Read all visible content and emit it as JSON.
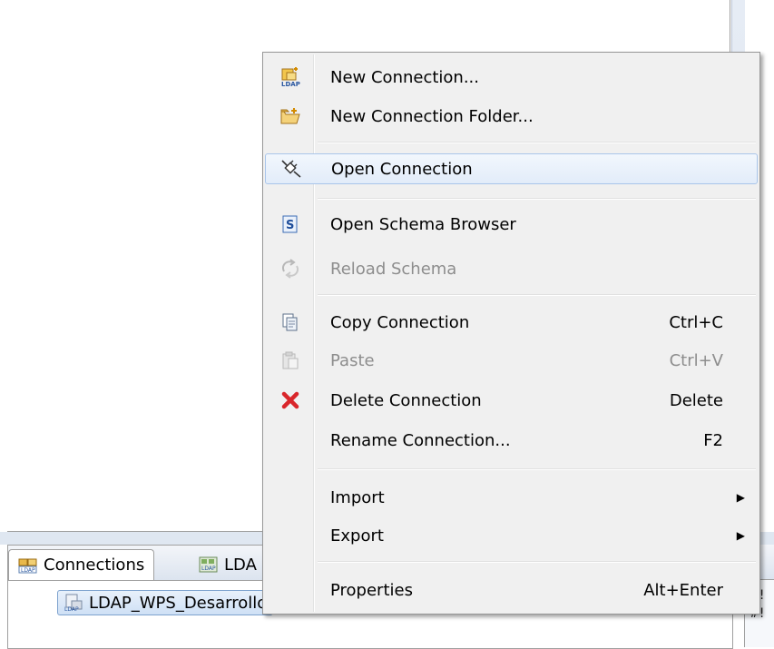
{
  "menu": {
    "items": [
      {
        "label": "New Connection...",
        "shortcut": "",
        "icon": "new-ldap-connection-icon"
      },
      {
        "label": "New Connection Folder...",
        "shortcut": "",
        "icon": "new-folder-icon"
      },
      {
        "label": "Open Connection",
        "shortcut": "",
        "icon": "plug-connect-icon",
        "highlighted": true
      },
      {
        "label": "Open Schema Browser",
        "shortcut": "",
        "icon": "schema-icon"
      },
      {
        "label": "Reload Schema",
        "shortcut": "",
        "icon": "reload-icon",
        "disabled": true
      },
      {
        "label": "Copy Connection",
        "shortcut": "Ctrl+C",
        "icon": "copy-icon"
      },
      {
        "label": "Paste",
        "shortcut": "Ctrl+V",
        "icon": "paste-icon",
        "disabled": true
      },
      {
        "label": "Delete Connection",
        "shortcut": "Delete",
        "icon": "delete-icon"
      },
      {
        "label": "Rename Connection...",
        "shortcut": "F2",
        "icon": ""
      },
      {
        "label": "Import",
        "shortcut": "",
        "icon": "",
        "submenu": true
      },
      {
        "label": "Export",
        "shortcut": "",
        "icon": "",
        "submenu": true
      },
      {
        "label": "Properties",
        "shortcut": "Alt+Enter",
        "icon": ""
      }
    ]
  },
  "panel": {
    "tab_connections": "Connections",
    "tab_ldap": "LDA",
    "tree_item": "LDAP_WPS_Desarrollo"
  },
  "right_panel": {
    "line1": "#!",
    "line2": "#!"
  },
  "colors": {
    "menu_bg": "#f0f0f0",
    "highlight_border": "#a9c5ea",
    "disabled_text": "#8d8d8d",
    "delete_red": "#d9262b"
  }
}
